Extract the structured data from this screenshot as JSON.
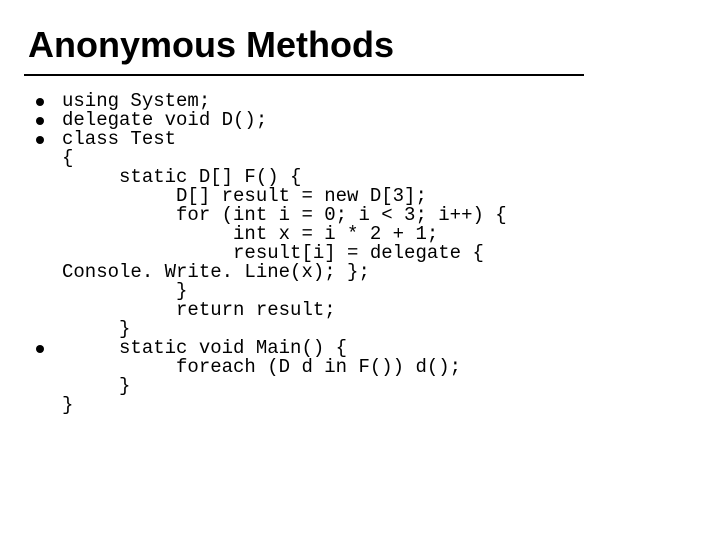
{
  "title": "Anonymous Methods",
  "lines": [
    {
      "bullet": true,
      "text": "using System;"
    },
    {
      "bullet": true,
      "text": "delegate void D();"
    },
    {
      "bullet": true,
      "text": "class Test"
    },
    {
      "bullet": false,
      "text": "{"
    },
    {
      "bullet": false,
      "text": "     static D[] F() {"
    },
    {
      "bullet": false,
      "text": "          D[] result = new D[3];"
    },
    {
      "bullet": false,
      "text": "          for (int i = 0; i < 3; i++) {"
    },
    {
      "bullet": false,
      "text": "               int x = i * 2 + 1;"
    },
    {
      "bullet": false,
      "text": "               result[i] = delegate {"
    },
    {
      "bullet": false,
      "text": "Console. Write. Line(x); };"
    },
    {
      "bullet": false,
      "text": "          }"
    },
    {
      "bullet": false,
      "text": "          return result;"
    },
    {
      "bullet": false,
      "text": "     }"
    },
    {
      "bullet": true,
      "text": "     static void Main() {"
    },
    {
      "bullet": false,
      "text": "          foreach (D d in F()) d();"
    },
    {
      "bullet": false,
      "text": "     }"
    },
    {
      "bullet": false,
      "text": "}"
    }
  ]
}
